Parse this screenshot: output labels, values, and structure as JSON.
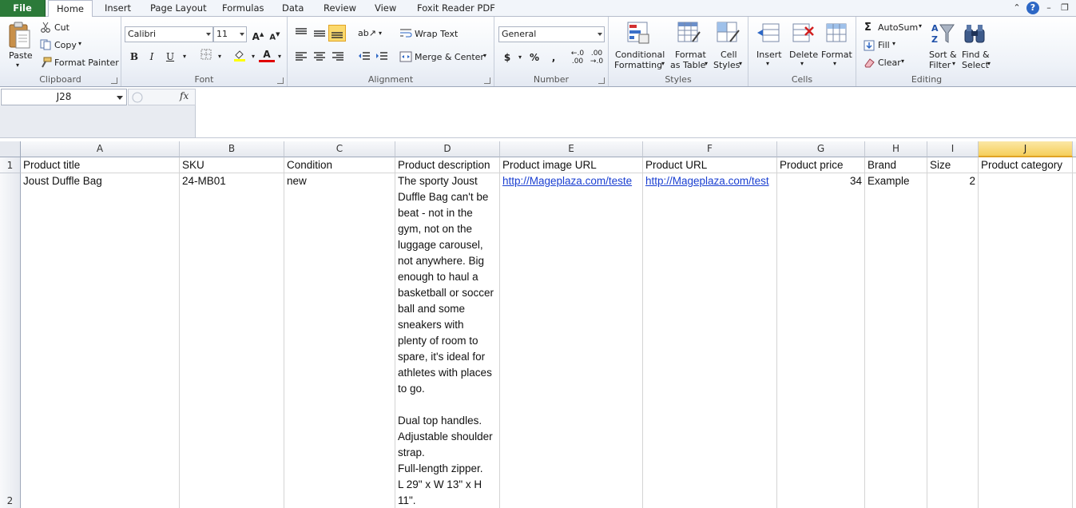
{
  "tabs": [
    "File",
    "Home",
    "Insert",
    "Page Layout",
    "Formulas",
    "Data",
    "Review",
    "View",
    "Foxit Reader PDF"
  ],
  "ribbon": {
    "clipboard": {
      "label": "Clipboard",
      "paste": "Paste",
      "cut": "Cut",
      "copy": "Copy",
      "format_painter": "Format Painter"
    },
    "font": {
      "label": "Font",
      "name": "Calibri",
      "size": "11"
    },
    "alignment": {
      "label": "Alignment",
      "wrap_text": "Wrap Text",
      "merge_center": "Merge & Center"
    },
    "number": {
      "label": "Number",
      "format": "General"
    },
    "styles": {
      "label": "Styles",
      "conditional_1": "Conditional",
      "conditional_2": "Formatting",
      "format_table_1": "Format",
      "format_table_2": "as Table",
      "cell_styles_1": "Cell",
      "cell_styles_2": "Styles"
    },
    "cells": {
      "label": "Cells",
      "insert": "Insert",
      "delete": "Delete",
      "format": "Format"
    },
    "editing": {
      "label": "Editing",
      "autosum": "AutoSum",
      "fill": "Fill",
      "clear": "Clear",
      "sort_1": "Sort &",
      "sort_2": "Filter",
      "find_1": "Find &",
      "find_2": "Select"
    }
  },
  "formula_bar": {
    "name_box": "J28",
    "fx": "fx",
    "value": ""
  },
  "grid": {
    "columns": [
      "A",
      "B",
      "C",
      "D",
      "E",
      "F",
      "G",
      "H",
      "I",
      "J"
    ],
    "rows": [
      "1",
      "2"
    ],
    "header_row": [
      "Product title",
      "SKU",
      "Condition",
      "Product description",
      "Product image URL",
      "Product URL",
      "Product price",
      "Brand",
      "Size",
      "Product category"
    ],
    "data_row": {
      "title": "Joust Duffle Bag",
      "sku": "24-MB01",
      "condition": "new",
      "description": "The sporty Joust\nDuffle Bag can't be\nbeat - not in the\ngym, not on the\nluggage carousel,\nnot anywhere. Big\nenough to haul a\nbasketball or soccer\nball and some\nsneakers with\nplenty of room to\nspare, it's ideal for\nathletes with places\nto go.\n\nDual top handles.\nAdjustable shoulder\nstrap.\nFull-length zipper.\nL 29\" x W 13\" x H 11\".",
      "image_url": "http://Mageplaza.com/teste",
      "product_url": "http://Mageplaza.com/test",
      "price": "34",
      "brand": "Example",
      "size": "2",
      "category": ""
    }
  }
}
